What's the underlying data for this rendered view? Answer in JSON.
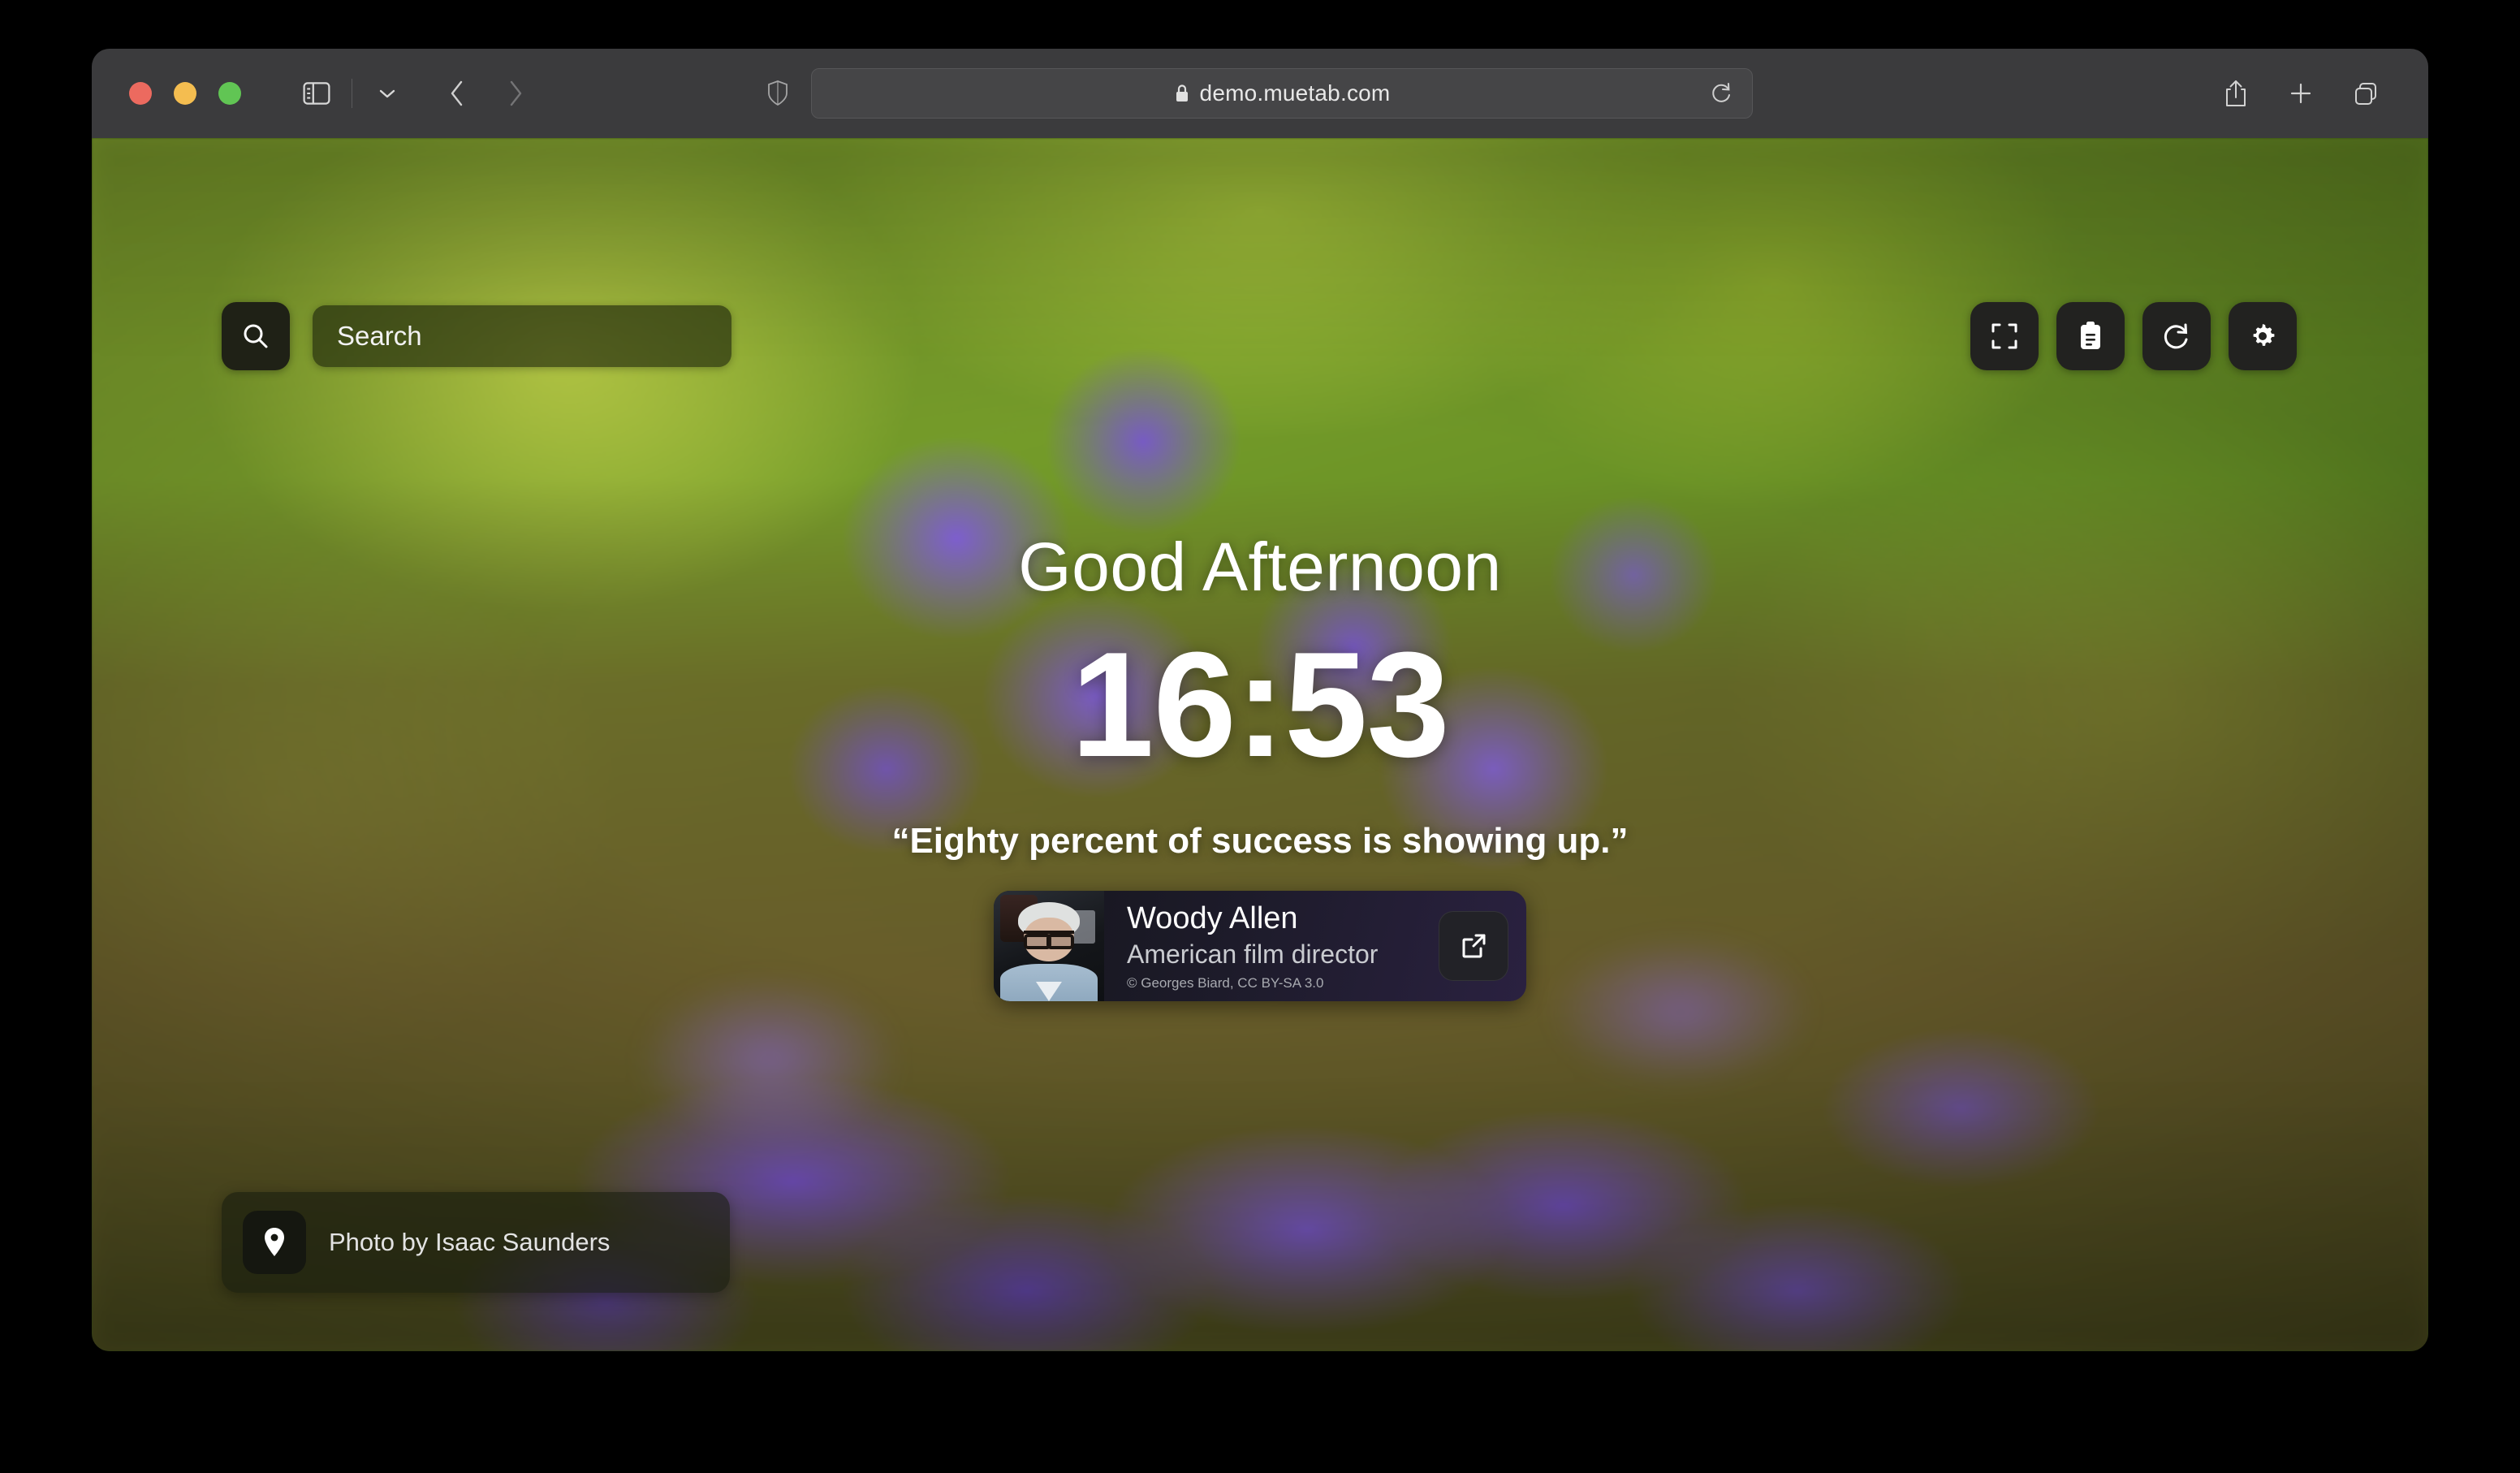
{
  "browser": {
    "window_controls": [
      "close",
      "minimize",
      "zoom"
    ],
    "sidebar_toggle": "sidebar-toggle",
    "tab_overview_chevron": "chevron-down",
    "back": "back",
    "forward": "forward",
    "shield": "privacy-shield",
    "url": "demo.muetab.com",
    "lock": "•",
    "reload": "reload",
    "share": "share",
    "new_tab": "new-tab",
    "tabs": "show-tabs",
    "colors": {
      "chrome": "#3b3b3d",
      "url_bar": "#454547",
      "close": "#ec6a5f",
      "minimize": "#f4bd50",
      "zoom": "#61c554"
    }
  },
  "newtab": {
    "search": {
      "button_label": "search-icon",
      "placeholder": "Search",
      "value": ""
    },
    "quick_actions": [
      {
        "name": "fullscreen",
        "label": "Toggle fullscreen"
      },
      {
        "name": "notes",
        "label": "Notes"
      },
      {
        "name": "refresh",
        "label": "Refresh background"
      },
      {
        "name": "settings",
        "label": "Settings"
      }
    ],
    "greeting": "Good Afternoon",
    "clock": "16:53",
    "quote": "“Eighty percent of success is showing up.”",
    "author": {
      "name": "Woody Allen",
      "role": "American film director",
      "credit": "© Georges Biard, CC BY-SA 3.0",
      "link_label": "external-link"
    },
    "photo_credit": {
      "icon": "location-pin",
      "text": "Photo by Isaac Saunders"
    },
    "colors": {
      "panel": "#1f2116",
      "card_start": "#16161d",
      "card_end": "#2a2140",
      "text": "#ffffff"
    }
  }
}
